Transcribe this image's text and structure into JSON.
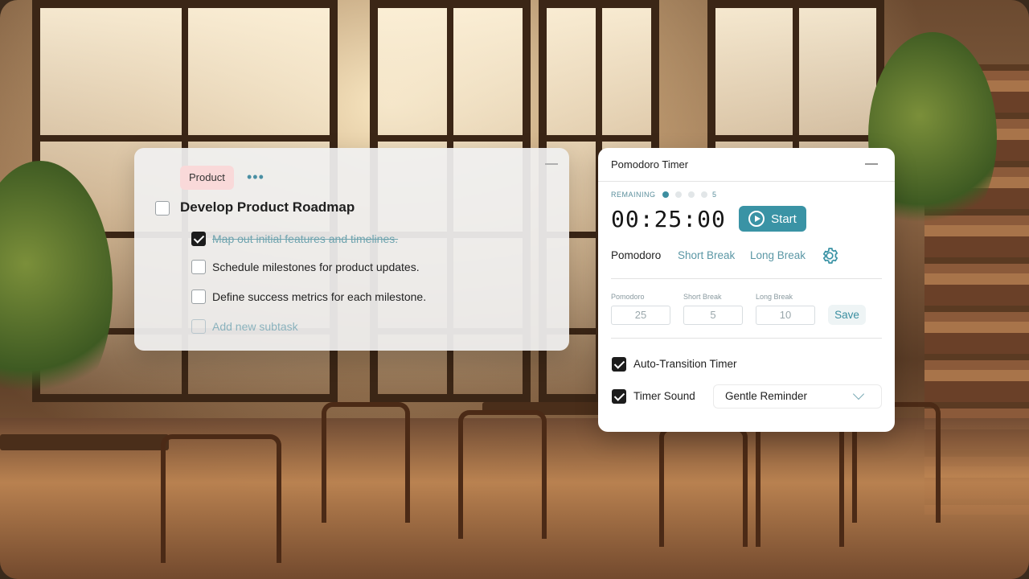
{
  "task_card": {
    "tag": "Product",
    "more_glyph": "•••",
    "title": "Develop Product Roadmap",
    "subtasks": [
      {
        "label": "Map out initial features and timelines.",
        "checked": true
      },
      {
        "label": "Schedule milestones for product updates.",
        "checked": false
      },
      {
        "label": "Define success metrics for each milestone.",
        "checked": false
      }
    ],
    "add_placeholder": "Add new subtask"
  },
  "pomodoro": {
    "title": "Pomodoro Timer",
    "remaining_label": "REMAINING",
    "remaining_count": "5",
    "progress_dots": [
      true,
      false,
      false,
      false
    ],
    "timer": "00:25:00",
    "start_label": "Start",
    "modes": [
      "Pomodoro",
      "Short Break",
      "Long Break"
    ],
    "active_mode": "Pomodoro",
    "durations": [
      {
        "label": "Pomodoro",
        "value": "25"
      },
      {
        "label": "Short Break",
        "value": "5"
      },
      {
        "label": "Long Break",
        "value": "10"
      }
    ],
    "save_label": "Save",
    "auto_transition": {
      "label": "Auto-Transition Timer",
      "checked": true
    },
    "timer_sound": {
      "label": "Timer Sound",
      "checked": true,
      "value": "Gentle Reminder"
    }
  },
  "colors": {
    "accent": "#3a93a5",
    "tag_bg": "#f9d9d9"
  }
}
